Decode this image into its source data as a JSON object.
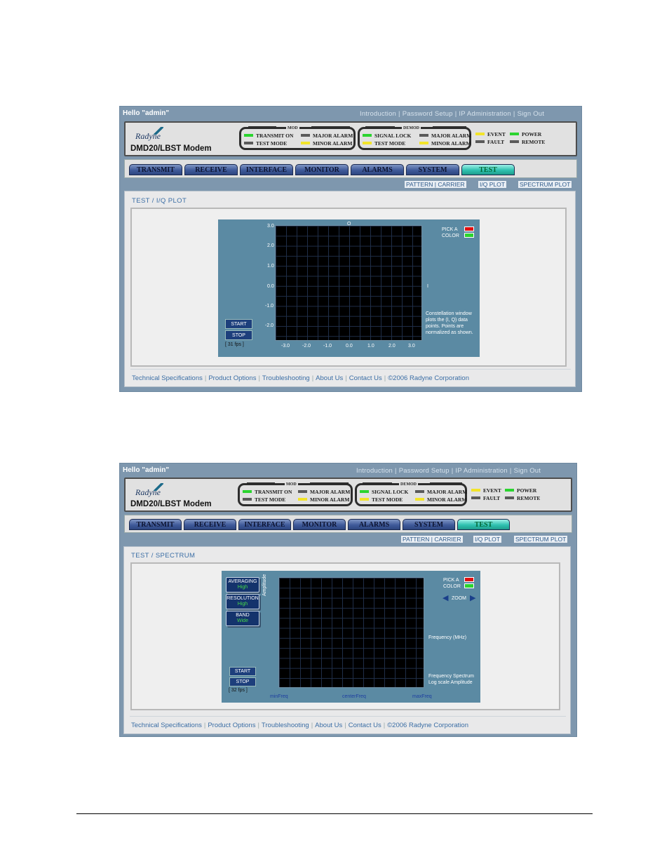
{
  "user_greeting": "Hello \"admin\"",
  "top_links": [
    "Introduction",
    "Password Setup",
    "IP Administration",
    "Sign Out"
  ],
  "logo_text": "Radyne",
  "model": "DMD20/LBST Modem",
  "mod": {
    "title": "MOD",
    "indicators": [
      {
        "label": "TRANSMIT ON",
        "color": "#2bd42f"
      },
      {
        "label": "TEST MODE",
        "color": "#5a5a5a"
      },
      {
        "label": "MAJOR ALARM",
        "color": "#5a5a5a"
      },
      {
        "label": "MINOR ALARM",
        "color": "#f2e42a"
      }
    ]
  },
  "demod": {
    "title": "DEMOD",
    "indicators": [
      {
        "label": "SIGNAL LOCK",
        "color": "#2bd42f"
      },
      {
        "label": "TEST MODE",
        "color": "#f2e42a"
      },
      {
        "label": "MAJOR ALARM",
        "color": "#5a5a5a"
      },
      {
        "label": "MINOR ALARM",
        "color": "#f2e42a"
      }
    ]
  },
  "status": [
    {
      "label": "EVENT",
      "color": "#f2e42a"
    },
    {
      "label": "FAULT",
      "color": "#5a5a5a"
    },
    {
      "label": "POWER",
      "color": "#2bd42f"
    },
    {
      "label": "REMOTE",
      "color": "#5a5a5a"
    }
  ],
  "tabs": [
    "TRANSMIT",
    "RECEIVE",
    "INTERFACE",
    "MONITOR",
    "ALARMS",
    "SYSTEM",
    "TEST"
  ],
  "active_tab": "TEST",
  "subnav": [
    "PATTERN | CARRIER",
    "I/Q PLOT",
    "SPECTRUM PLOT"
  ],
  "iq": {
    "breadcrumb": "TEST / I/Q PLOT",
    "q_label": "Q",
    "i_label": "I",
    "y_ticks": [
      "3.0",
      "2.0",
      "1.0",
      "0.0",
      "-1.0",
      "-2.0"
    ],
    "x_ticks": [
      "-3.0",
      "-2.0",
      "-1.0",
      "0.0",
      "1.0",
      "2.0",
      "3.0"
    ],
    "pick_color": [
      "PICK A",
      "COLOR"
    ],
    "start": "START",
    "stop": "STOP",
    "fps": "[ 31 fps ]",
    "note": "Constellation window plots the (I, Q) data points. Points are normalized as shown."
  },
  "spectrum": {
    "breadcrumb": "TEST / SPECTRUM",
    "averaging": {
      "label": "AVERAGING",
      "value": "High"
    },
    "resolution": {
      "label": "RESOLUTION",
      "value": "High"
    },
    "band": {
      "label": "BAND",
      "value": "Wide"
    },
    "amplitude_label": "Amplitude",
    "pick_color": [
      "PICK A",
      "COLOR"
    ],
    "zoom": "ZOOM",
    "freq_label": "Frequency (MHz)",
    "note": "Frequency Spectrum Log scale Amplitude",
    "start": "START",
    "stop": "STOP",
    "fps": "[ 32 fps ]",
    "x_labels": [
      "minFreq",
      "centerFreq",
      "maxFreq"
    ]
  },
  "footer_links": [
    "Technical Specifications",
    "Product Options",
    "Troubleshooting",
    "About Us",
    "Contact Us",
    "©2006 Radyne Corporation"
  ],
  "swatch_colors": {
    "red": "#e01010",
    "green": "#2bd42f"
  }
}
